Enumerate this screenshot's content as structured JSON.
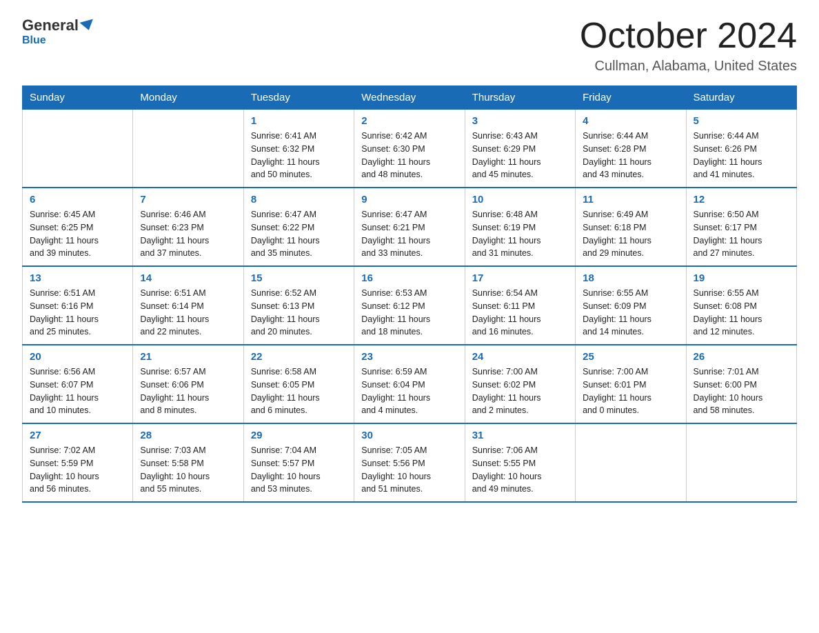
{
  "logo": {
    "general": "General",
    "blue": "Blue"
  },
  "title": "October 2024",
  "location": "Cullman, Alabama, United States",
  "days_of_week": [
    "Sunday",
    "Monday",
    "Tuesday",
    "Wednesday",
    "Thursday",
    "Friday",
    "Saturday"
  ],
  "weeks": [
    [
      {
        "day": "",
        "info": ""
      },
      {
        "day": "",
        "info": ""
      },
      {
        "day": "1",
        "info": "Sunrise: 6:41 AM\nSunset: 6:32 PM\nDaylight: 11 hours\nand 50 minutes."
      },
      {
        "day": "2",
        "info": "Sunrise: 6:42 AM\nSunset: 6:30 PM\nDaylight: 11 hours\nand 48 minutes."
      },
      {
        "day": "3",
        "info": "Sunrise: 6:43 AM\nSunset: 6:29 PM\nDaylight: 11 hours\nand 45 minutes."
      },
      {
        "day": "4",
        "info": "Sunrise: 6:44 AM\nSunset: 6:28 PM\nDaylight: 11 hours\nand 43 minutes."
      },
      {
        "day": "5",
        "info": "Sunrise: 6:44 AM\nSunset: 6:26 PM\nDaylight: 11 hours\nand 41 minutes."
      }
    ],
    [
      {
        "day": "6",
        "info": "Sunrise: 6:45 AM\nSunset: 6:25 PM\nDaylight: 11 hours\nand 39 minutes."
      },
      {
        "day": "7",
        "info": "Sunrise: 6:46 AM\nSunset: 6:23 PM\nDaylight: 11 hours\nand 37 minutes."
      },
      {
        "day": "8",
        "info": "Sunrise: 6:47 AM\nSunset: 6:22 PM\nDaylight: 11 hours\nand 35 minutes."
      },
      {
        "day": "9",
        "info": "Sunrise: 6:47 AM\nSunset: 6:21 PM\nDaylight: 11 hours\nand 33 minutes."
      },
      {
        "day": "10",
        "info": "Sunrise: 6:48 AM\nSunset: 6:19 PM\nDaylight: 11 hours\nand 31 minutes."
      },
      {
        "day": "11",
        "info": "Sunrise: 6:49 AM\nSunset: 6:18 PM\nDaylight: 11 hours\nand 29 minutes."
      },
      {
        "day": "12",
        "info": "Sunrise: 6:50 AM\nSunset: 6:17 PM\nDaylight: 11 hours\nand 27 minutes."
      }
    ],
    [
      {
        "day": "13",
        "info": "Sunrise: 6:51 AM\nSunset: 6:16 PM\nDaylight: 11 hours\nand 25 minutes."
      },
      {
        "day": "14",
        "info": "Sunrise: 6:51 AM\nSunset: 6:14 PM\nDaylight: 11 hours\nand 22 minutes."
      },
      {
        "day": "15",
        "info": "Sunrise: 6:52 AM\nSunset: 6:13 PM\nDaylight: 11 hours\nand 20 minutes."
      },
      {
        "day": "16",
        "info": "Sunrise: 6:53 AM\nSunset: 6:12 PM\nDaylight: 11 hours\nand 18 minutes."
      },
      {
        "day": "17",
        "info": "Sunrise: 6:54 AM\nSunset: 6:11 PM\nDaylight: 11 hours\nand 16 minutes."
      },
      {
        "day": "18",
        "info": "Sunrise: 6:55 AM\nSunset: 6:09 PM\nDaylight: 11 hours\nand 14 minutes."
      },
      {
        "day": "19",
        "info": "Sunrise: 6:55 AM\nSunset: 6:08 PM\nDaylight: 11 hours\nand 12 minutes."
      }
    ],
    [
      {
        "day": "20",
        "info": "Sunrise: 6:56 AM\nSunset: 6:07 PM\nDaylight: 11 hours\nand 10 minutes."
      },
      {
        "day": "21",
        "info": "Sunrise: 6:57 AM\nSunset: 6:06 PM\nDaylight: 11 hours\nand 8 minutes."
      },
      {
        "day": "22",
        "info": "Sunrise: 6:58 AM\nSunset: 6:05 PM\nDaylight: 11 hours\nand 6 minutes."
      },
      {
        "day": "23",
        "info": "Sunrise: 6:59 AM\nSunset: 6:04 PM\nDaylight: 11 hours\nand 4 minutes."
      },
      {
        "day": "24",
        "info": "Sunrise: 7:00 AM\nSunset: 6:02 PM\nDaylight: 11 hours\nand 2 minutes."
      },
      {
        "day": "25",
        "info": "Sunrise: 7:00 AM\nSunset: 6:01 PM\nDaylight: 11 hours\nand 0 minutes."
      },
      {
        "day": "26",
        "info": "Sunrise: 7:01 AM\nSunset: 6:00 PM\nDaylight: 10 hours\nand 58 minutes."
      }
    ],
    [
      {
        "day": "27",
        "info": "Sunrise: 7:02 AM\nSunset: 5:59 PM\nDaylight: 10 hours\nand 56 minutes."
      },
      {
        "day": "28",
        "info": "Sunrise: 7:03 AM\nSunset: 5:58 PM\nDaylight: 10 hours\nand 55 minutes."
      },
      {
        "day": "29",
        "info": "Sunrise: 7:04 AM\nSunset: 5:57 PM\nDaylight: 10 hours\nand 53 minutes."
      },
      {
        "day": "30",
        "info": "Sunrise: 7:05 AM\nSunset: 5:56 PM\nDaylight: 10 hours\nand 51 minutes."
      },
      {
        "day": "31",
        "info": "Sunrise: 7:06 AM\nSunset: 5:55 PM\nDaylight: 10 hours\nand 49 minutes."
      },
      {
        "day": "",
        "info": ""
      },
      {
        "day": "",
        "info": ""
      }
    ]
  ]
}
